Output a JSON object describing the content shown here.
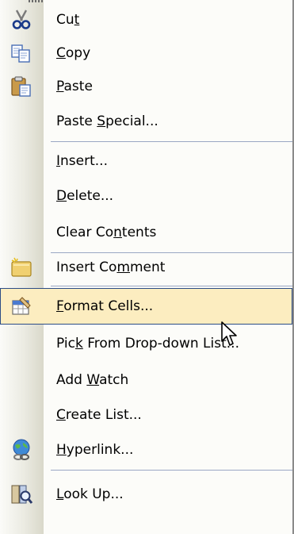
{
  "menu": {
    "items": [
      {
        "pre": "Cu",
        "acc": "t",
        "post": ""
      },
      {
        "pre": "",
        "acc": "C",
        "post": "opy"
      },
      {
        "pre": "",
        "acc": "P",
        "post": "aste"
      },
      {
        "pre": "Paste ",
        "acc": "S",
        "post": "pecial..."
      },
      {
        "pre": "",
        "acc": "I",
        "post": "nsert..."
      },
      {
        "pre": "",
        "acc": "D",
        "post": "elete..."
      },
      {
        "pre": "Clear Co",
        "acc": "n",
        "post": "tents"
      },
      {
        "pre": "Insert Co",
        "acc": "m",
        "post": "ment"
      },
      {
        "pre": "",
        "acc": "F",
        "post": "ormat Cells..."
      },
      {
        "pre": "Pic",
        "acc": "k",
        "post": " From Drop-down List..."
      },
      {
        "pre": "Add ",
        "acc": "W",
        "post": "atch"
      },
      {
        "pre": "",
        "acc": "C",
        "post": "reate List..."
      },
      {
        "pre": "",
        "acc": "H",
        "post": "yperlink..."
      },
      {
        "pre": "",
        "acc": "L",
        "post": "ook Up..."
      }
    ],
    "icons": [
      "scissors-icon",
      "copy-icon",
      "paste-icon",
      "comment-icon",
      "format-cells-icon",
      "hyperlink-icon",
      "research-icon"
    ],
    "highlighted_item": "Format Cells...",
    "colors": {
      "highlight_fill": "#fcedc0",
      "highlight_border": "#2c4c86",
      "separator": "#9aa7c4",
      "gutter": "#e4e3d7"
    }
  }
}
